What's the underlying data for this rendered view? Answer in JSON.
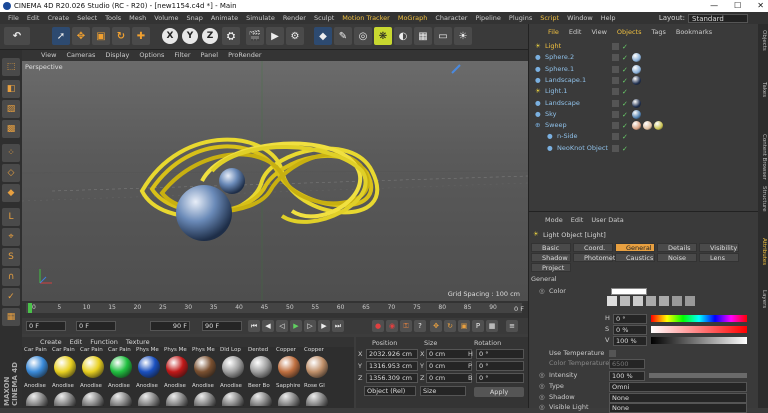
{
  "titlebar": {
    "title": "CINEMA 4D R20.026 Studio (RC - R20) - [new1154.c4d *] - Main",
    "min": "—",
    "max": "☐",
    "close": "✕"
  },
  "menubar": [
    "File",
    "Edit",
    "Create",
    "Select",
    "Tools",
    "Mesh",
    "Volume",
    "Snap",
    "Animate",
    "Simulate",
    "Render",
    "Sculpt",
    "Motion Tracker",
    "MoGraph",
    "Character",
    "Pipeline",
    "Plugins",
    "Script",
    "Window",
    "Help"
  ],
  "layout": {
    "label": "Layout:",
    "value": "Standard"
  },
  "viewport": {
    "menu": [
      "View",
      "Cameras",
      "Display",
      "Options",
      "Filter",
      "Panel",
      "ProRender"
    ],
    "label": "Perspective",
    "grid_spacing": "Grid Spacing : 100 cm"
  },
  "timeline": {
    "ticks": [
      "0",
      "5",
      "10",
      "15",
      "20",
      "25",
      "30",
      "35",
      "40",
      "45",
      "50",
      "55",
      "60",
      "65",
      "70",
      "75",
      "80",
      "85",
      "90"
    ],
    "right": "0 F"
  },
  "transport": {
    "start": "0 F",
    "current": "0 F",
    "end": "90 F",
    "end2": "90 F"
  },
  "materials": {
    "menu": [
      "Create",
      "Edit",
      "Function",
      "Texture"
    ],
    "top": [
      {
        "name": "Car Pain",
        "color": "#3a8ad8"
      },
      {
        "name": "Car Pain",
        "color": "#e8d020"
      },
      {
        "name": "Car Pain",
        "color": "#e8d020"
      },
      {
        "name": "Car Pain",
        "color": "#20c040"
      },
      {
        "name": "Phys Me",
        "color": "#1a50c0"
      },
      {
        "name": "Phys Me",
        "color": "#c01818"
      },
      {
        "name": "Phys Me",
        "color": "#7a5030"
      },
      {
        "name": "Dld Lop",
        "color": "#a0a0a0"
      },
      {
        "name": "Dented",
        "color": "#a0a0a0"
      },
      {
        "name": "Copper",
        "color": "#c07040"
      },
      {
        "name": "Copper",
        "color": "#c0906a"
      }
    ],
    "bottom": [
      "Anodise",
      "Anodise",
      "Anodise",
      "Anodise",
      "Anodise",
      "Anodise",
      "Anodise",
      "Anodise",
      "Beer Bo",
      "Sapphire",
      "Rose Gl"
    ]
  },
  "coords": {
    "headers": [
      "Position",
      "Size",
      "Rotation"
    ],
    "rows": [
      {
        "axis": "X",
        "pos": "2032.926 cm",
        "size": "0 cm",
        "rlab": "H",
        "rot": "0 °"
      },
      {
        "axis": "Y",
        "pos": "1316.953 cm",
        "size": "0 cm",
        "rlab": "P",
        "rot": "0 °"
      },
      {
        "axis": "Z",
        "pos": "1356.309 cm",
        "size": "0 cm",
        "rlab": "B",
        "rot": "0 °"
      }
    ],
    "mode": "Object (Rel)",
    "mode2": "Size",
    "apply": "Apply"
  },
  "objects": {
    "menu": [
      "File",
      "Edit",
      "View",
      "Objects",
      "Tags",
      "Bookmarks"
    ],
    "items": [
      {
        "name": "Light",
        "color": "#f0c040"
      },
      {
        "name": "Sphere.2"
      },
      {
        "name": "Sphere.1"
      },
      {
        "name": "Landscape.1"
      },
      {
        "name": "Light.1"
      },
      {
        "name": "Landscape"
      },
      {
        "name": "Sky"
      },
      {
        "name": "Sweep"
      },
      {
        "name": "n-Side"
      },
      {
        "name": "NeoKnot Object"
      }
    ]
  },
  "attributes": {
    "menu": [
      "Mode",
      "Edit",
      "User Data"
    ],
    "object": "Light Object [Light]",
    "tabs": [
      "Basic",
      "Coord.",
      "General",
      "Details",
      "Visibility",
      "Shadow",
      "Photometric",
      "Caustics",
      "Noise",
      "Lens",
      "Project"
    ],
    "section": "General",
    "color_label": "Color",
    "h": "H",
    "h_val": "0 °",
    "s": "S",
    "s_val": "0 %",
    "v": "V",
    "v_val": "100 %",
    "use_temp": "Use Temperature",
    "color_temp": "Color Temperature",
    "color_temp_val": "6500",
    "intensity": "Intensity",
    "intensity_val": "100 %",
    "type": "Type",
    "type_val": "Omni",
    "shadow": "Shadow",
    "shadow_val": "None",
    "visible_light": "Visible Light",
    "visible_val": "None"
  },
  "right_tabs": [
    "Objects",
    "Takes",
    "Content Browser",
    "Structure",
    "Attributes",
    "Layers"
  ]
}
